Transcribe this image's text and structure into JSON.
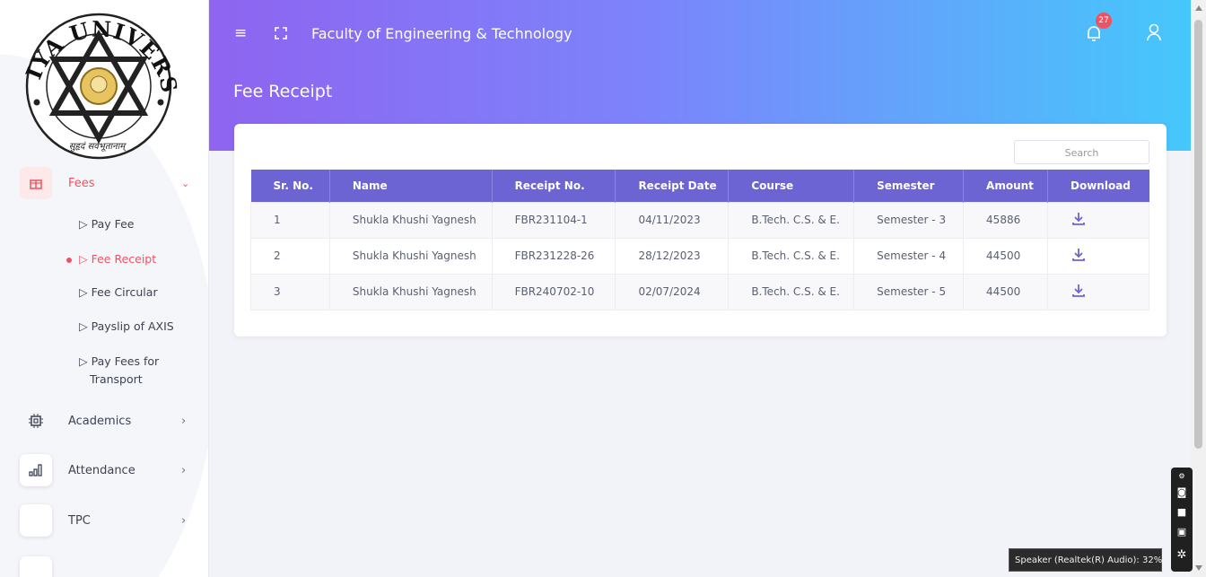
{
  "logo": {
    "arc_text": "ATMIYA UNIVERSITY",
    "motto": "सुहृदं सर्वभूतानाम्"
  },
  "sidebar": {
    "items": [
      {
        "label": "Fees",
        "icon": "gift-icon",
        "active": true
      },
      {
        "label": "Academics",
        "icon": "chip-icon"
      },
      {
        "label": "Attendance",
        "icon": "bar-chart-icon"
      },
      {
        "label": "TPC",
        "icon": "blank-icon"
      }
    ],
    "fees_sub": [
      {
        "label": "▷ Pay Fee"
      },
      {
        "label": "▷ Fee Receipt",
        "active": true
      },
      {
        "label": "▷ Fee Circular"
      },
      {
        "label": "▷ Payslip of AXIS"
      },
      {
        "label": "▷ Pay Fees for",
        "label2": "Transport"
      }
    ]
  },
  "header": {
    "faculty": "Faculty of Engineering & Technology",
    "page_title": "Fee Receipt",
    "notification_count": "27"
  },
  "search": {
    "placeholder": "Search"
  },
  "table": {
    "columns": [
      "Sr. No.",
      "Name",
      "Receipt No.",
      "Receipt Date",
      "Course",
      "Semester",
      "Amount",
      "Download"
    ],
    "rows": [
      [
        "1",
        "Shukla Khushi Yagnesh",
        "FBR231104-1",
        "04/11/2023",
        "B.Tech. C.S. & E.",
        "Semester - 3",
        "45886"
      ],
      [
        "2",
        "Shukla Khushi Yagnesh",
        "FBR231228-26",
        "28/12/2023",
        "B.Tech. C.S. & E.",
        "Semester - 4",
        "44500"
      ],
      [
        "3",
        "Shukla Khushi Yagnesh",
        "FBR240702-10",
        "02/07/2024",
        "B.Tech. C.S. & E.",
        "Semester - 5",
        "44500"
      ]
    ]
  },
  "tooltip": "Speaker (Realtek(R) Audio): 32%",
  "colors": {
    "accent": "#f05262",
    "table_header": "#6c64d3",
    "gradient_start": "#8e64f0",
    "gradient_end": "#45c8fb"
  }
}
